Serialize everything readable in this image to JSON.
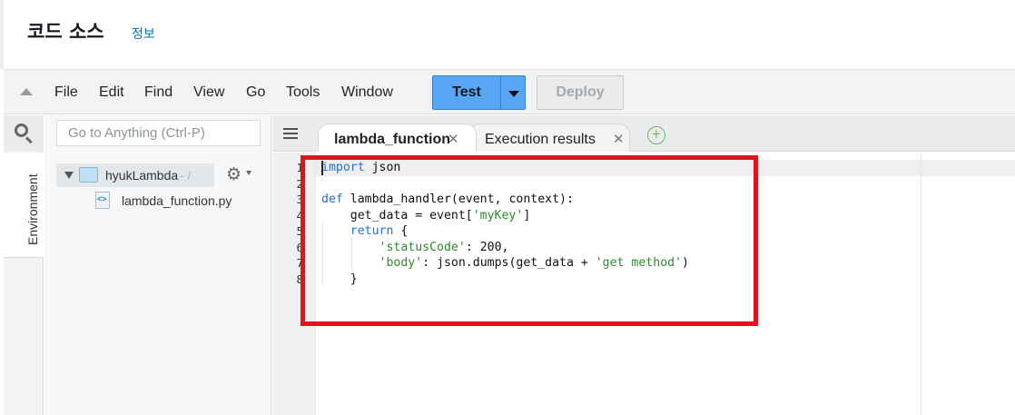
{
  "header": {
    "title": "코드 소스",
    "info_link": "정보"
  },
  "menubar": {
    "items": [
      "File",
      "Edit",
      "Find",
      "View",
      "Go",
      "Tools",
      "Window"
    ],
    "test_label": "Test",
    "deploy_label": "Deploy"
  },
  "sidebar": {
    "environment_label": "Environment",
    "goto_placeholder": "Go to Anything (Ctrl-P)"
  },
  "file_tree": {
    "folder_name": "hyukLambda",
    "folder_path_suffix": "- /",
    "files": [
      "lambda_function.py"
    ]
  },
  "tabs": [
    {
      "label": "lambda_function",
      "active": true
    },
    {
      "label": "Execution results",
      "active": false
    }
  ],
  "editor": {
    "line_numbers": [
      "1",
      "2",
      "3",
      "4",
      "5",
      "6",
      "7",
      "8"
    ],
    "lines": [
      [
        {
          "t": "import",
          "k": "kw"
        },
        {
          "t": " json",
          "k": ""
        }
      ],
      [],
      [
        {
          "t": "def",
          "k": "kw"
        },
        {
          "t": " lambda_handler(event, context):",
          "k": ""
        }
      ],
      [
        {
          "t": "    get_data = event[",
          "k": ""
        },
        {
          "t": "'myKey'",
          "k": "str"
        },
        {
          "t": "]",
          "k": ""
        }
      ],
      [
        {
          "t": "    ",
          "k": ""
        },
        {
          "t": "return",
          "k": "kw"
        },
        {
          "t": " {",
          "k": ""
        }
      ],
      [
        {
          "t": "        ",
          "k": ""
        },
        {
          "t": "'statusCode'",
          "k": "str"
        },
        {
          "t": ": 200,",
          "k": ""
        }
      ],
      [
        {
          "t": "        ",
          "k": ""
        },
        {
          "t": "'body'",
          "k": "str"
        },
        {
          "t": ": json.dumps(get_data + ",
          "k": ""
        },
        {
          "t": "'get method'",
          "k": "str"
        },
        {
          "t": ")",
          "k": ""
        }
      ],
      [
        {
          "t": "    }",
          "k": ""
        }
      ]
    ]
  },
  "colors": {
    "accent_button": "#59a6f5",
    "highlight_border": "#e8101a",
    "keyword": "#1e6fd9",
    "string": "#2c8a2c"
  }
}
